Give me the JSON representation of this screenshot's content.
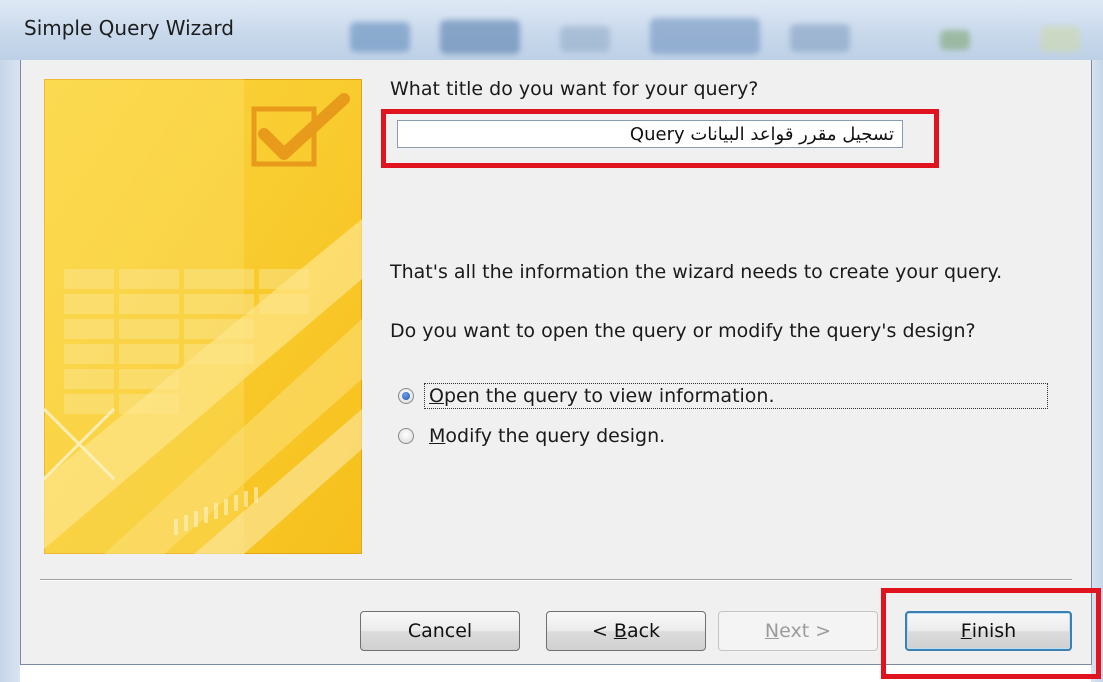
{
  "window": {
    "title": "Simple Query Wizard"
  },
  "wizard": {
    "question": "What title do you want for your query?",
    "query_title_value": "تسجيل مقرر قواعد البيانات Query",
    "info": "That's all the information the wizard needs to create your query.",
    "prompt": "Do you want to open the query or modify the query's design?",
    "options": [
      {
        "mnemonic": "O",
        "rest": "pen the query to view information.",
        "selected": true
      },
      {
        "mnemonic": "M",
        "rest": "odify the query design.",
        "selected": false
      }
    ]
  },
  "buttons": {
    "cancel": "Cancel",
    "back_prefix": "< ",
    "back_mnemonic": "B",
    "back_rest": "ack",
    "next_mnemonic": "N",
    "next_rest": "ext >",
    "finish_mnemonic": "F",
    "finish_rest": "inish"
  },
  "colors": {
    "highlight": "#e0141e",
    "wizard_image": "#f9c92a",
    "dialog_bg": "#f0f0f0"
  },
  "icons": {
    "wizard_image": "checkmark-icon"
  }
}
